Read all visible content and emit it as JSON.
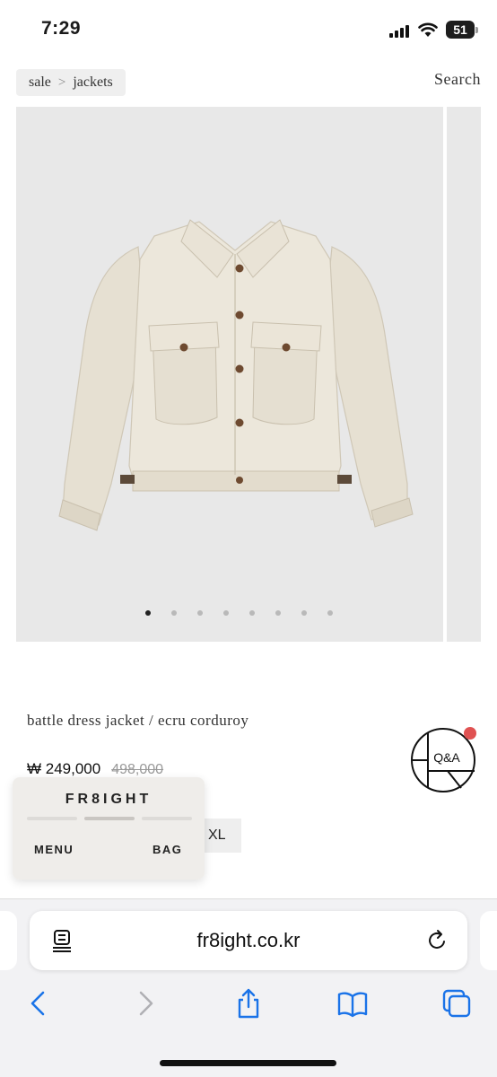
{
  "status_bar": {
    "time": "7:29",
    "battery": "51"
  },
  "breadcrumb": {
    "items": [
      "sale",
      "jackets"
    ],
    "separator": ">"
  },
  "header": {
    "search_label": "Search"
  },
  "gallery": {
    "slide_count": 8,
    "active_slide": 1
  },
  "product": {
    "name": "battle dress jacket / ecru corduroy",
    "price": "₩ 249,000",
    "original_price": "498,000",
    "size_visible": "XL"
  },
  "qa_badge": {
    "label": "Q&A",
    "notification_color": "#e05252"
  },
  "floating_nav": {
    "brand": "FR8IGHT",
    "menu_label": "MENU",
    "bag_label": "BAG"
  },
  "browser": {
    "url": "fr8ight.co.kr"
  },
  "colors": {
    "accent": "#1a73e8",
    "gallery_bg": "#e8e8e8",
    "jacket": "#e9e3d6"
  }
}
